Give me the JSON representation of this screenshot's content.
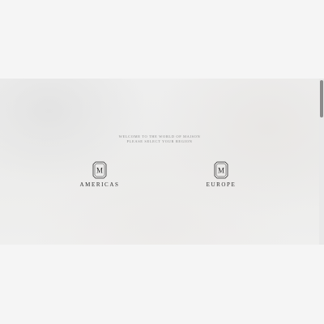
{
  "hero": {
    "welcome_line1": "WELCOME TO THE WORLD OF MAISON",
    "welcome_line2": "PLEASE SELECT YOUR REGION"
  },
  "regions": [
    {
      "label": "AMERICAS",
      "logo_letter": "M"
    },
    {
      "label": "EUROPE",
      "logo_letter": "M"
    }
  ],
  "colors": {
    "page_background": "#f5f5f5",
    "label_text": "#2e2e2e",
    "welcome_text": "#8e8e8e"
  }
}
